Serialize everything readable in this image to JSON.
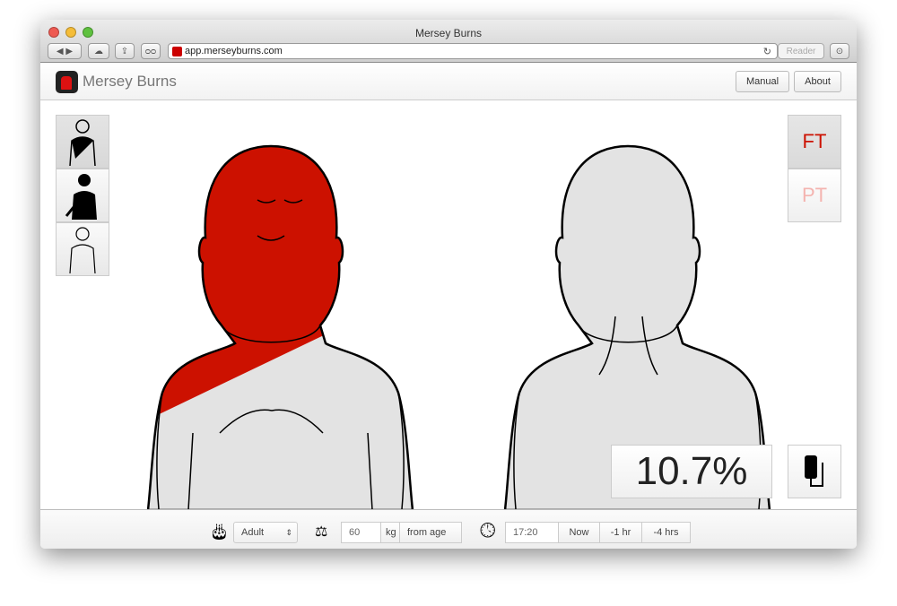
{
  "browser": {
    "title": "Mersey Burns",
    "url": "app.merseyburns.com",
    "reader_label": "Reader"
  },
  "app": {
    "name": "Mersey Burns",
    "manual_label": "Manual",
    "about_label": "About"
  },
  "tools": [
    "partial-body-brush",
    "body-part-fill",
    "clear-body"
  ],
  "thickness": {
    "ft_label": "FT",
    "pt_label": "PT",
    "selected": "FT"
  },
  "tbsa": {
    "value": "10.7%"
  },
  "colors": {
    "burn": "#cc1100",
    "body": "#e3e3e3",
    "ft": "#cc1100",
    "pt": "#f4b4b0"
  },
  "footer": {
    "age_group": "Adult",
    "weight": "60",
    "weight_unit": "kg",
    "from_age_label": "from age",
    "time": "17:20",
    "now_label": "Now",
    "minus1_label": "-1 hr",
    "minus4_label": "-4 hrs"
  }
}
